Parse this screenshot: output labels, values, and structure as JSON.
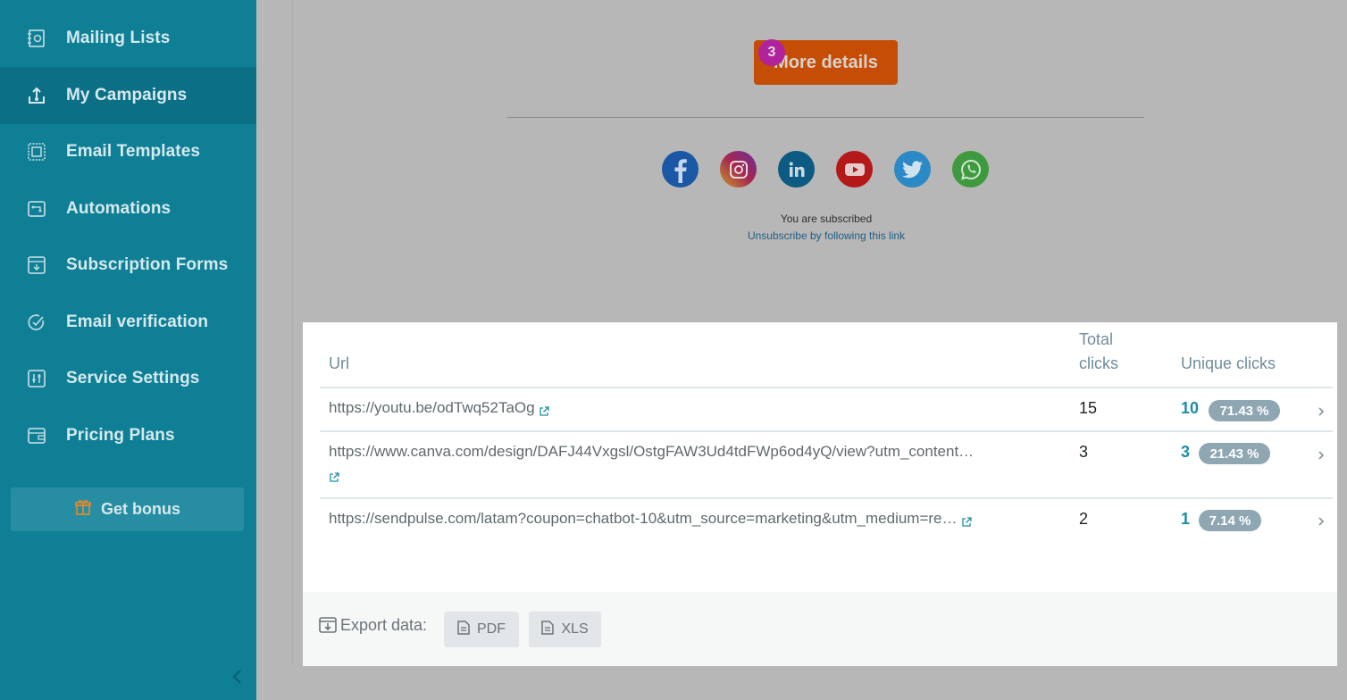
{
  "sidebar": {
    "items": [
      {
        "label": "Mailing Lists",
        "icon": "mailing-lists-icon"
      },
      {
        "label": "My Campaigns",
        "icon": "campaigns-upload-icon",
        "active": true
      },
      {
        "label": "Email Templates",
        "icon": "templates-icon"
      },
      {
        "label": "Automations",
        "icon": "automations-icon"
      },
      {
        "label": "Subscription Forms",
        "icon": "subscription-forms-icon"
      },
      {
        "label": "Email verification",
        "icon": "verification-check-icon"
      },
      {
        "label": "Service Settings",
        "icon": "settings-sliders-icon"
      },
      {
        "label": "Pricing Plans",
        "icon": "wallet-icon"
      }
    ],
    "bonus_label": "Get bonus"
  },
  "preview": {
    "button_label": "More details",
    "badge": "3",
    "subscribed_text": "You are subscribed",
    "unsubscribe_text": "Unsubscribe by following this link",
    "social": [
      "facebook",
      "instagram",
      "linkedin",
      "youtube",
      "twitter",
      "whatsapp"
    ]
  },
  "table": {
    "headers": {
      "url": "Url",
      "total_line1": "Total",
      "total_line2": "clicks",
      "unique": "Unique clicks"
    },
    "rows": [
      {
        "url": "https://youtu.be/odTwq52TaOg",
        "total": "15",
        "unique": "10",
        "pct": "71.43 %"
      },
      {
        "url": "https://www.canva.com/design/DAFJ44Vxgsl/OstgFAW3Ud4tdFWp6od4yQ/view?utm_content…",
        "total": "3",
        "unique": "3",
        "pct": "21.43 %"
      },
      {
        "url": "https://sendpulse.com/latam?coupon=chatbot-10&utm_source=marketing&utm_medium=re…",
        "total": "2",
        "unique": "1",
        "pct": "7.14 %"
      }
    ]
  },
  "export": {
    "label": "Export data:",
    "pdf": "PDF",
    "xls": "XLS"
  },
  "colors": {
    "sidebar_bg": "#0f7f96",
    "sidebar_active": "#0b6f85",
    "cta_orange": "#c54d05",
    "link_teal": "#1d8ea5",
    "pct_badge": "#8ea7b3"
  }
}
